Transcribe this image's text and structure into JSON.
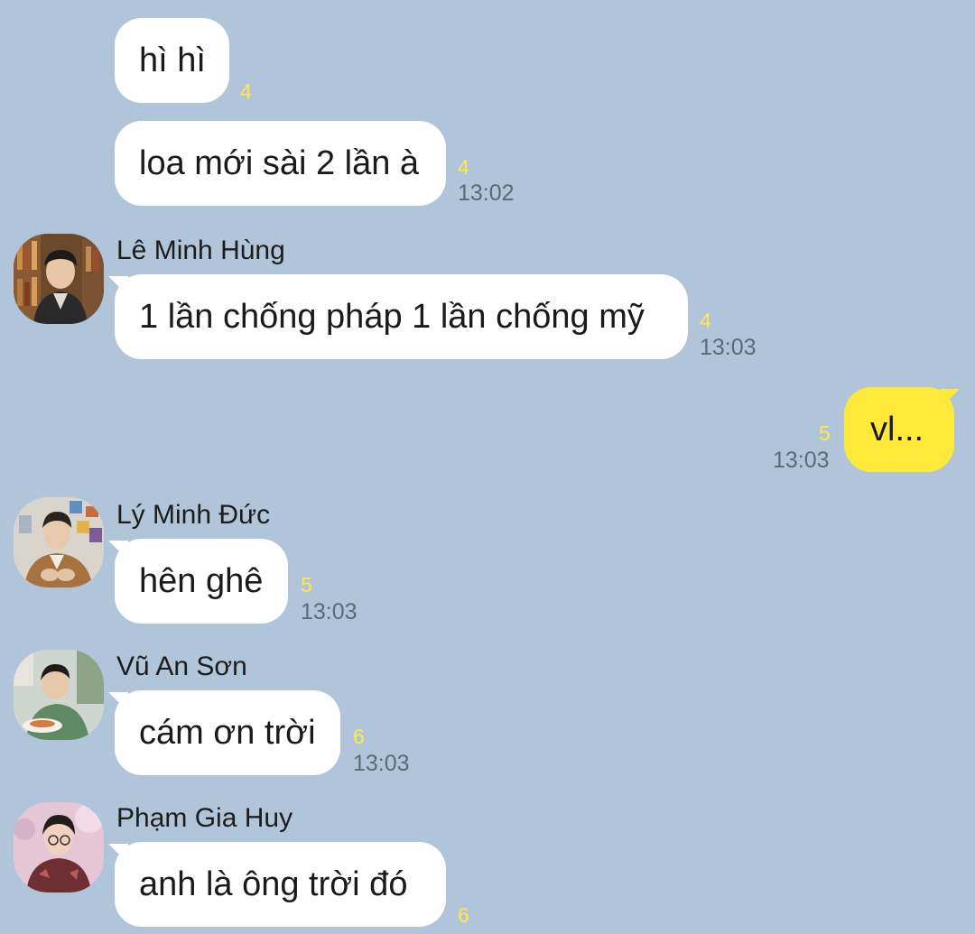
{
  "messages": [
    {
      "id": "m1",
      "text": "hì hì",
      "unread": "4"
    },
    {
      "id": "m2",
      "text": "loa mới sài 2 lần à",
      "unread": "4",
      "time": "13:02"
    },
    {
      "id": "m3",
      "sender": "Lê Minh Hùng",
      "text": "1 lần chống pháp 1 lần chống mỹ",
      "unread": "4",
      "time": "13:03"
    },
    {
      "id": "m4",
      "text": "vl...",
      "unread": "5",
      "time": "13:03",
      "mine": true
    },
    {
      "id": "m5",
      "sender": "Lý Minh Đức",
      "text": "hên ghê",
      "unread": "5",
      "time": "13:03"
    },
    {
      "id": "m6",
      "sender": "Vũ An Sơn",
      "text": "cám ơn trời",
      "unread": "6",
      "time": "13:03"
    },
    {
      "id": "m7",
      "sender": "Phạm Gia Huy",
      "text": "anh là ông trời đó",
      "unread": "6"
    }
  ],
  "colors": {
    "background": "#b0c5d9",
    "incoming_bubble": "#ffffff",
    "outgoing_bubble": "#fee93b",
    "unread_count": "#ffe94a",
    "timestamp": "#5d6a75"
  }
}
